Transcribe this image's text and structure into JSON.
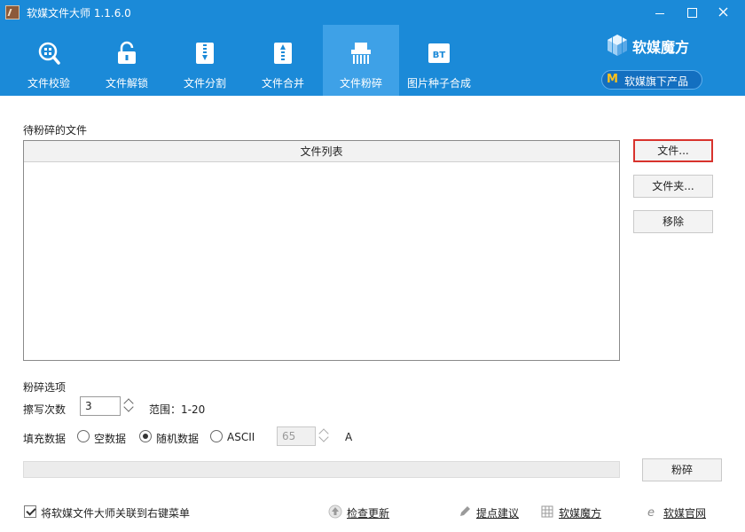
{
  "window": {
    "title": "软媒文件大师 1.1.6.0"
  },
  "tabs": [
    {
      "label": "文件校验",
      "icon": "magnifier-grid-icon",
      "active": false
    },
    {
      "label": "文件解锁",
      "icon": "unlock-icon",
      "active": false
    },
    {
      "label": "文件分割",
      "icon": "zipper-split-icon",
      "active": false
    },
    {
      "label": "文件合并",
      "icon": "zipper-merge-icon",
      "active": false
    },
    {
      "label": "文件粉碎",
      "icon": "shredder-icon",
      "active": true
    },
    {
      "label": "图片种子合成",
      "icon": "bt-icon",
      "active": false,
      "icon_text": "BT"
    }
  ],
  "brand": {
    "name": "软媒魔方",
    "pill_label": "软媒旗下产品",
    "pill_logo": "M"
  },
  "file_section": {
    "label": "待粉碎的文件",
    "list_header": "文件列表"
  },
  "side_buttons": {
    "file": "文件...",
    "folder": "文件夹...",
    "remove": "移除"
  },
  "options": {
    "title": "粉碎选项",
    "overwrite_label": "擦写次数",
    "overwrite_value": "3",
    "range_text": "范围：1-20",
    "fill_label": "填充数据",
    "fill_options": [
      {
        "label": "空数据",
        "checked": false
      },
      {
        "label": "随机数据",
        "checked": true
      },
      {
        "label": "ASCII",
        "checked": false
      }
    ],
    "ascii_value": "65",
    "ascii_char": "A"
  },
  "progress": {
    "value": 0
  },
  "shred_button": "粉碎",
  "footer": {
    "context_menu_label": "将软媒文件大师关联到右键菜单",
    "context_menu_checked": true,
    "links": [
      "检查更新",
      "提点建议",
      "软媒魔方",
      "软媒官网"
    ]
  },
  "colors": {
    "header": "#1b8ad8",
    "active_tab": "#3ea1e7",
    "highlight_border": "#d8332d"
  }
}
